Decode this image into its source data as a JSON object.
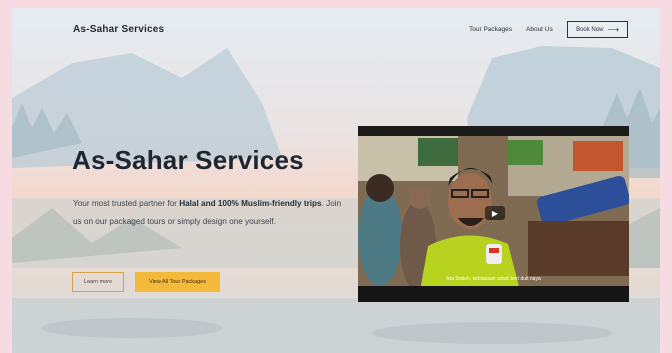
{
  "nav": {
    "brand": "As-Sahar Services",
    "links": [
      "Tour Packages",
      "About Us"
    ],
    "book_label": "Book Now",
    "book_arrow": "⟶"
  },
  "hero": {
    "title": "As-Sahar Services",
    "lead_prefix": "Your most trusted partner for ",
    "lead_bold": "Halal and 100% Muslim-friendly trips",
    "lead_suffix": ". Join us on our packaged tours or simply design one yourself.",
    "learn_label": "Learn more",
    "packages_label": "View All Tour Packages"
  },
  "video": {
    "caption": "ikta Sodeh, kebiasaan untuk bert duit naya",
    "play_icon": "play-icon"
  },
  "colors": {
    "accent": "#f2b93b",
    "text_dark": "#1e2731"
  }
}
